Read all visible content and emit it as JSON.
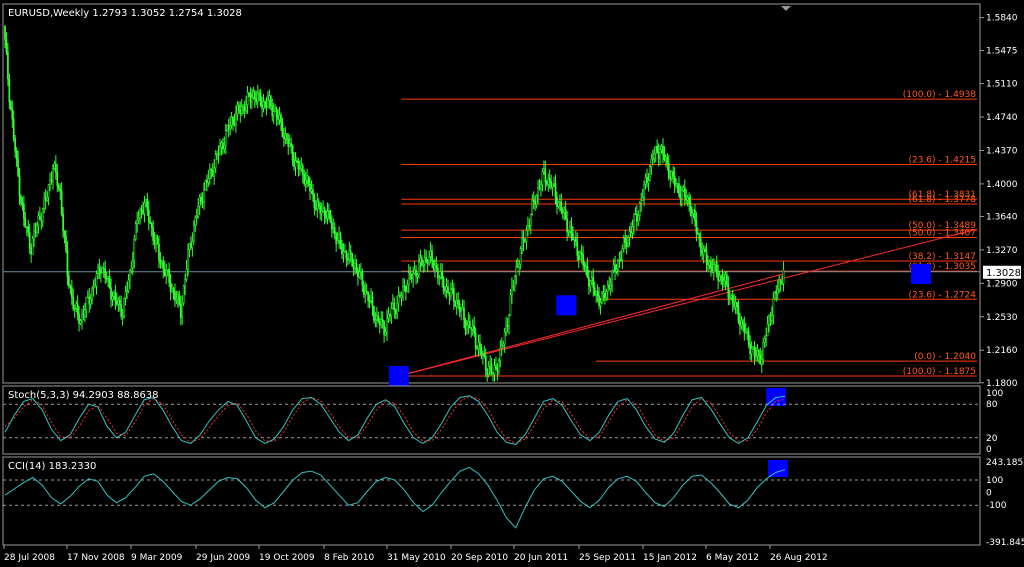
{
  "chart_data": {
    "type": "candlestick",
    "main": {
      "header": "EURUSD,Weekly  1.2793 1.3052 1.2754 1.3028",
      "ylim": [
        1.1875,
        1.5935
      ],
      "y_ticks": [
        "1.5840",
        "1.5475",
        "1.5110",
        "1.4740",
        "1.4370",
        "1.4000",
        "1.3640",
        "1.3270",
        "1.2900",
        "1.2530",
        "1.2160",
        "1.1800"
      ],
      "current_price_label": "1.3028",
      "current_price": 1.3028,
      "close_path": [
        [
          0,
          1.575
        ],
        [
          4,
          1.5
        ],
        [
          9,
          1.42
        ],
        [
          14,
          1.36
        ],
        [
          19,
          1.33
        ],
        [
          24,
          1.36
        ],
        [
          29,
          1.38
        ],
        [
          34,
          1.42
        ],
        [
          39,
          1.39
        ],
        [
          44,
          1.3
        ],
        [
          49,
          1.26
        ],
        [
          53,
          1.25
        ],
        [
          58,
          1.27
        ],
        [
          63,
          1.29
        ],
        [
          67,
          1.31
        ],
        [
          72,
          1.29
        ],
        [
          77,
          1.27
        ],
        [
          82,
          1.26
        ],
        [
          87,
          1.3
        ],
        [
          92,
          1.36
        ],
        [
          97,
          1.38
        ],
        [
          102,
          1.35
        ],
        [
          107,
          1.32
        ],
        [
          112,
          1.3
        ],
        [
          117,
          1.28
        ],
        [
          122,
          1.26
        ],
        [
          127,
          1.32
        ],
        [
          132,
          1.36
        ],
        [
          137,
          1.39
        ],
        [
          142,
          1.41
        ],
        [
          147,
          1.43
        ],
        [
          152,
          1.45
        ],
        [
          157,
          1.47
        ],
        [
          162,
          1.48
        ],
        [
          167,
          1.49
        ],
        [
          172,
          1.5
        ],
        [
          177,
          1.49
        ],
        [
          182,
          1.49
        ],
        [
          187,
          1.48
        ],
        [
          192,
          1.46
        ],
        [
          197,
          1.44
        ],
        [
          202,
          1.42
        ],
        [
          207,
          1.41
        ],
        [
          212,
          1.39
        ],
        [
          217,
          1.37
        ],
        [
          222,
          1.37
        ],
        [
          227,
          1.35
        ],
        [
          232,
          1.33
        ],
        [
          237,
          1.32
        ],
        [
          242,
          1.31
        ],
        [
          247,
          1.29
        ],
        [
          252,
          1.27
        ],
        [
          257,
          1.25
        ],
        [
          262,
          1.24
        ],
        [
          267,
          1.26
        ],
        [
          272,
          1.27
        ],
        [
          277,
          1.29
        ],
        [
          282,
          1.3
        ],
        [
          287,
          1.31
        ],
        [
          292,
          1.32
        ],
        [
          297,
          1.31
        ],
        [
          302,
          1.29
        ],
        [
          307,
          1.28
        ],
        [
          312,
          1.27
        ],
        [
          317,
          1.25
        ],
        [
          322,
          1.24
        ],
        [
          327,
          1.22
        ],
        [
          332,
          1.2
        ],
        [
          337,
          1.19
        ],
        [
          342,
          1.21
        ],
        [
          347,
          1.25
        ],
        [
          352,
          1.3
        ],
        [
          357,
          1.33
        ],
        [
          362,
          1.36
        ],
        [
          367,
          1.39
        ],
        [
          372,
          1.41
        ],
        [
          377,
          1.4
        ],
        [
          382,
          1.38
        ],
        [
          387,
          1.36
        ],
        [
          392,
          1.34
        ],
        [
          397,
          1.32
        ],
        [
          402,
          1.3
        ],
        [
          407,
          1.28
        ],
        [
          412,
          1.27
        ],
        [
          417,
          1.29
        ],
        [
          422,
          1.31
        ],
        [
          427,
          1.33
        ],
        [
          432,
          1.35
        ],
        [
          437,
          1.37
        ],
        [
          442,
          1.4
        ],
        [
          447,
          1.43
        ],
        [
          452,
          1.44
        ],
        [
          457,
          1.42
        ],
        [
          462,
          1.4
        ],
        [
          467,
          1.39
        ],
        [
          472,
          1.38
        ],
        [
          477,
          1.35
        ],
        [
          482,
          1.32
        ],
        [
          487,
          1.31
        ],
        [
          492,
          1.3
        ],
        [
          497,
          1.29
        ],
        [
          502,
          1.27
        ],
        [
          507,
          1.25
        ],
        [
          512,
          1.23
        ],
        [
          517,
          1.21
        ],
        [
          522,
          1.21
        ],
        [
          527,
          1.25
        ],
        [
          532,
          1.28
        ],
        [
          537,
          1.303
        ]
      ],
      "highlight_boxes": [
        [
          0.1397,
          1.1875
        ],
        [
          0.3326,
          1.2657
        ],
        [
          0.7181,
          1.3003
        ]
      ],
      "trend_lines": [
        {
          "from": [
            0.1397,
            1.1875
          ],
          "to": [
            0.7181,
            1.3003
          ],
          "color": "#ff2a2a"
        },
        {
          "from": [
            0.1397,
            1.1875
          ],
          "to": [
            1.0,
            1.35
          ],
          "color": "#ff2a2a"
        }
      ],
      "fib_levels": [
        {
          "label": "(100.0) - 1.4938",
          "value": 1.4938,
          "start_frac": 0.13
        },
        {
          "label": "(23.6) - 1.4215",
          "value": 1.4215,
          "start_frac": 0.13
        },
        {
          "label": "(61.8) - 1.3831",
          "value": 1.3831,
          "start_frac": 0.13
        },
        {
          "label": "(61.8) - 1.3778",
          "value": 1.3778,
          "start_frac": 0.13
        },
        {
          "label": "(50.0) - 1.3489",
          "value": 1.3489,
          "start_frac": 0.13
        },
        {
          "label": "(50.0) - 1.3407",
          "value": 1.3407,
          "start_frac": 0.13
        },
        {
          "label": "(38.2) - 1.3147",
          "value": 1.3147,
          "start_frac": 0.13
        },
        {
          "label": "(61.8) - 1.3035",
          "value": 1.3035,
          "start_frac": 0.13
        },
        {
          "label": "(23.6) - 1.2724",
          "value": 1.2724,
          "start_frac": 0.33
        },
        {
          "label": "(0.0) - 1.2040",
          "value": 1.204,
          "start_frac": 0.33
        },
        {
          "label": "(100.0) - 1.1875",
          "value": 1.1875,
          "start_frac": 0.13
        }
      ],
      "y_ticks_list": [
        1.584,
        1.5475,
        1.511,
        1.474,
        1.437,
        1.4,
        1.364,
        1.327,
        1.29,
        1.253,
        1.216,
        1.18
      ]
    },
    "stoch": {
      "header": "Stoch(5,3,3) 94.2903 88.8638",
      "ylim": [
        0,
        100
      ],
      "levels": [
        80,
        20
      ],
      "y_ticks": [
        "100",
        "80",
        "20",
        "0"
      ],
      "main_series": [
        30,
        60,
        85,
        90,
        70,
        35,
        15,
        25,
        55,
        80,
        75,
        40,
        20,
        30,
        60,
        88,
        92,
        70,
        40,
        15,
        10,
        25,
        50,
        70,
        85,
        78,
        50,
        20,
        10,
        18,
        40,
        70,
        90,
        92,
        80,
        55,
        30,
        15,
        25,
        55,
        80,
        88,
        75,
        45,
        20,
        10,
        20,
        45,
        75,
        92,
        95,
        85,
        60,
        30,
        12,
        8,
        25,
        55,
        85,
        90,
        78,
        50,
        25,
        15,
        30,
        60,
        85,
        90,
        70,
        40,
        18,
        12,
        28,
        60,
        88,
        92,
        72,
        45,
        20,
        10,
        20,
        48,
        78,
        92,
        94
      ],
      "signal_series": [
        40,
        55,
        75,
        88,
        78,
        48,
        22,
        20,
        40,
        68,
        78,
        55,
        28,
        24,
        48,
        78,
        90,
        80,
        52,
        25,
        12,
        18,
        38,
        60,
        78,
        82,
        62,
        32,
        14,
        14,
        30,
        58,
        82,
        92,
        86,
        65,
        40,
        20,
        20,
        42,
        70,
        85,
        82,
        58,
        30,
        14,
        15,
        35,
        62,
        85,
        94,
        90,
        72,
        42,
        18,
        10,
        18,
        42,
        72,
        88,
        84,
        62,
        35,
        18,
        22,
        48,
        75,
        88,
        80,
        52,
        25,
        14,
        20,
        45,
        76,
        90,
        82,
        58,
        30,
        14,
        15,
        35,
        65,
        85,
        89
      ]
    },
    "cci": {
      "header": "CCI(14) 183.2330",
      "ylim": [
        -391.845,
        243.1855
      ],
      "levels": [
        100,
        -100
      ],
      "y_ticks": [
        "243.1855",
        "100",
        "0",
        "-100",
        "-391.845"
      ],
      "series": [
        -20,
        30,
        80,
        120,
        60,
        -40,
        -90,
        -30,
        50,
        110,
        90,
        -20,
        -80,
        -40,
        40,
        130,
        150,
        90,
        10,
        -70,
        -100,
        -50,
        20,
        90,
        120,
        110,
        40,
        -60,
        -120,
        -80,
        10,
        100,
        160,
        170,
        140,
        60,
        -20,
        -100,
        -80,
        10,
        90,
        120,
        100,
        20,
        -80,
        -150,
        -100,
        0,
        90,
        170,
        200,
        150,
        60,
        -60,
        -200,
        -280,
        -120,
        20,
        110,
        130,
        90,
        10,
        -70,
        -120,
        -60,
        40,
        110,
        130,
        90,
        0,
        -80,
        -110,
        -40,
        60,
        130,
        140,
        80,
        0,
        -90,
        -120,
        -60,
        40,
        110,
        160,
        183
      ]
    },
    "x_axis": {
      "labels": [
        "28 Jul 2008",
        "17 Nov 2008",
        "9 Mar 2009",
        "29 Jun 2009",
        "19 Oct 2009",
        "8 Feb 2010",
        "31 May 2010",
        "20 Sep 2010",
        "20 Jun 2011",
        "25 Sep 2011",
        "15 Jan 2012",
        "6 May 2012",
        "26 Aug 2012"
      ]
    },
    "colors": {
      "background": "#000000",
      "candle": "#33ff33",
      "fib_line": "#ff3a00",
      "fib_text": "#ff5a1a",
      "trend_line": "#ff2a2a",
      "highlight": "#0000ff",
      "stoch_main": "#34c3c3",
      "stoch_signal": "#ff2a2a",
      "cci": "#34c3c3",
      "axis_text": "#ffffff",
      "panel_border": "#9a9a9a",
      "current_price_line": "#6e8fa0"
    }
  }
}
